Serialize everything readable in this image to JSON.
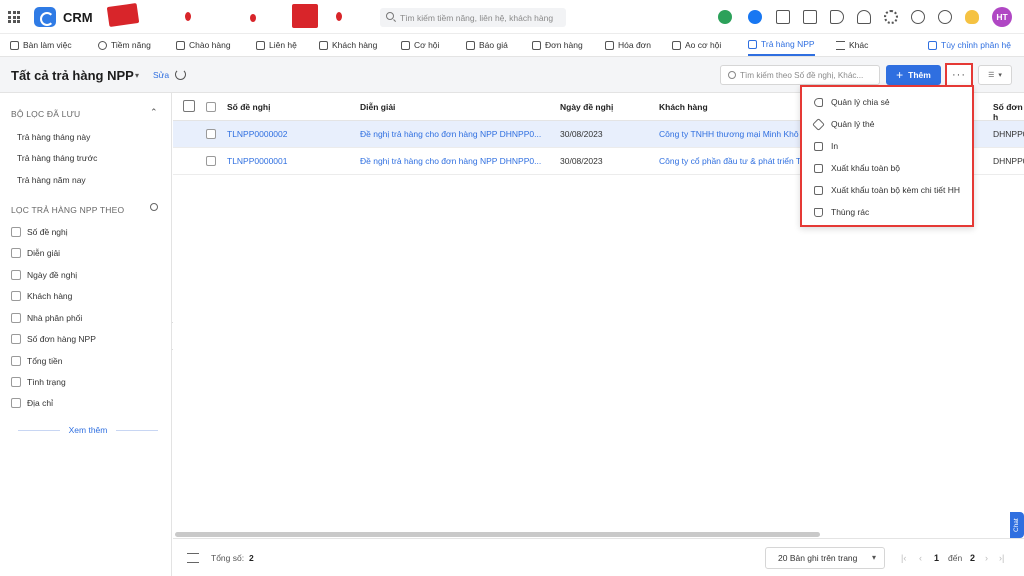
{
  "app": {
    "brand": "CRM",
    "user_initials": "HT"
  },
  "top_search": {
    "placeholder": "Tìm kiếm tiềm năng, liên hệ, khách hàng"
  },
  "colors": {
    "accent": "#2f6fe0",
    "highlight_border": "#e53935",
    "avatar": "#b047c4",
    "selected_row": "#e8effc"
  },
  "nav": {
    "tabs": [
      {
        "label": "Bàn làm việc"
      },
      {
        "label": "Tiềm năng"
      },
      {
        "label": "Chào hàng"
      },
      {
        "label": "Liên hệ"
      },
      {
        "label": "Khách hàng"
      },
      {
        "label": "Cơ hội"
      },
      {
        "label": "Báo giá"
      },
      {
        "label": "Đơn hàng"
      },
      {
        "label": "Hóa đơn"
      },
      {
        "label": "Ao cơ hội"
      },
      {
        "label": "Trả hàng NPP"
      },
      {
        "label": "Khác"
      }
    ],
    "customize": "Tùy chỉnh phân hệ"
  },
  "header": {
    "title": "Tất cả trả hàng NPP",
    "edit": "Sửa",
    "search_placeholder": "Tìm kiếm theo Số đề nghị, Khác...",
    "add_label": "Thêm",
    "more_label": "···"
  },
  "sidebar": {
    "saved_title": "BỘ LỌC ĐÃ LƯU",
    "saved": [
      "Trả hàng tháng này",
      "Trả hàng tháng trước",
      "Trả hàng năm nay"
    ],
    "filter_title": "LỌC TRẢ HÀNG NPP THEO",
    "filters": [
      "Số đề nghị",
      "Diễn giải",
      "Ngày đề nghị",
      "Khách hàng",
      "Nhà phân phối",
      "Số đơn hàng NPP",
      "Tổng tiền",
      "Tình trạng",
      "Địa chỉ"
    ],
    "see_more": "Xem thêm"
  },
  "table": {
    "headers": [
      "Số đề nghị",
      "Diễn giải",
      "Ngày đề nghị",
      "Khách hàng",
      "Số đơn h"
    ],
    "rows": [
      [
        "TLNPP0000002",
        "Đề nghị trả hàng cho đơn hàng NPP DHNPP0...",
        "30/08/2023",
        "Công ty TNHH thương mại Minh Khô",
        "DHNPP0"
      ],
      [
        "TLNPP0000001",
        "Đề nghị trả hàng cho đơn hàng NPP DHNPP0...",
        "30/08/2023",
        "Công ty cổ phần đầu tư & phát triển T",
        "DHNPP0"
      ]
    ]
  },
  "menu": {
    "items": [
      {
        "label": "Quản lý chia sẻ",
        "icon": "share-icon"
      },
      {
        "label": "Quản lý thẻ",
        "icon": "tag-icon"
      },
      {
        "label": "In",
        "icon": "printer-icon"
      },
      {
        "label": "Xuất khẩu toàn bộ",
        "icon": "export-icon"
      },
      {
        "label": "Xuất khẩu toàn bộ kèm chi tiết HH",
        "icon": "export-detail-icon"
      },
      {
        "label": "Thùng rác",
        "icon": "trash-icon"
      }
    ]
  },
  "footer": {
    "total_label": "Tổng số:",
    "total_value": "2",
    "page_size": "20 Bản ghi trên trang",
    "page_current": "1",
    "page_to": "đến",
    "page_total": "2"
  },
  "chat": "Chat"
}
